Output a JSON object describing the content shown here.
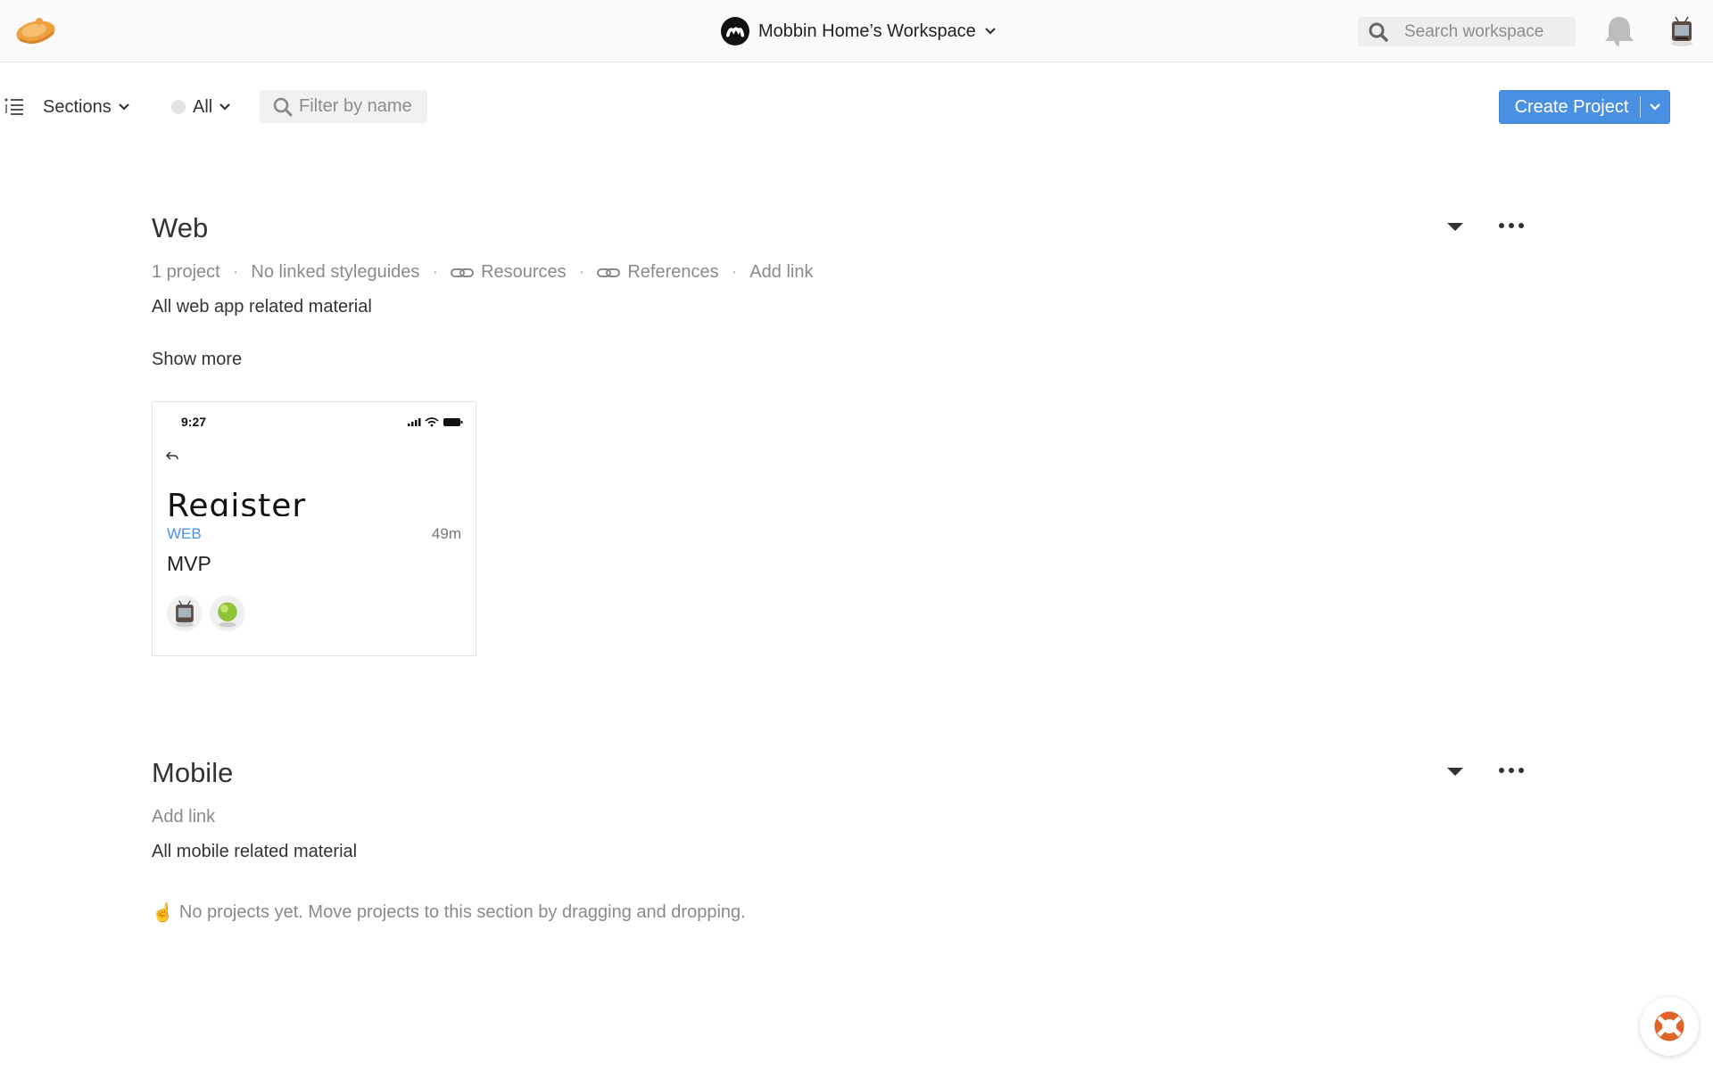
{
  "topbar": {
    "workspace_name": "Mobbin Home’s Workspace",
    "search_placeholder": "Search workspace"
  },
  "toolbar": {
    "sections_label": "Sections",
    "filter_all_label": "All",
    "filter_placeholder": "Filter by name",
    "create_label": "Create Project"
  },
  "sections": [
    {
      "title": "Web",
      "project_count": "1 project",
      "styleguides": "No linked styleguides",
      "links": [
        "Resources",
        "References"
      ],
      "add_link": "Add link",
      "description": "All web app related material",
      "show_more": "Show more",
      "projects": [
        {
          "thumb_time": "9:27",
          "thumb_heading": "Register",
          "tag": "WEB",
          "updated": "49m",
          "title": "MVP"
        }
      ]
    },
    {
      "title": "Mobile",
      "add_link": "Add link",
      "description": "All mobile related material",
      "empty_emoji": "☝️",
      "empty_text": "No projects yet. Move projects to this section by dragging and dropping."
    }
  ],
  "colors": {
    "accent": "#4a90e2",
    "logo": "#f0a040",
    "help": "#e0632a"
  }
}
